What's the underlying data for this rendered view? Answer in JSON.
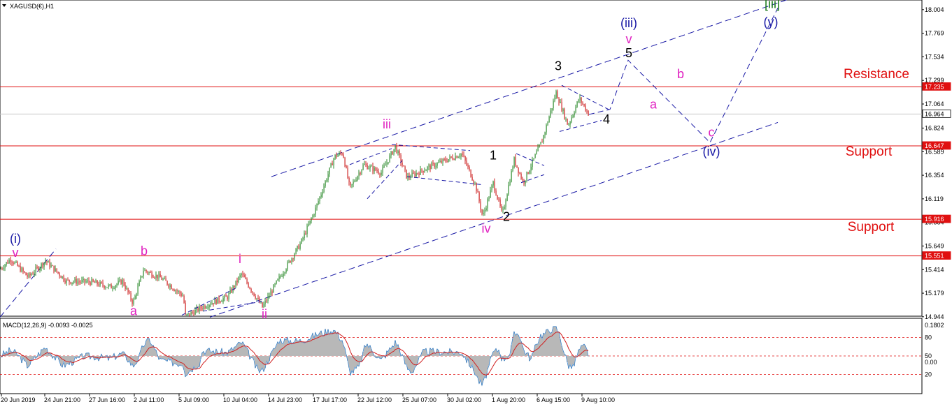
{
  "symbol_label": "XAGUSD(€),H1",
  "macd_label": "MACD(12,26,9) -0.0093 -0.0025",
  "chart_data": {
    "type": "line",
    "price_axis": {
      "ticks": [
        "18.004",
        "17.769",
        "17.534",
        "17.299",
        "17.064",
        "16.824",
        "16.589",
        "16.354",
        "16.119",
        "15.884",
        "15.649",
        "15.414",
        "15.179",
        "14.944"
      ],
      "range": [
        14.95,
        18.1
      ]
    },
    "price_tags": [
      {
        "value": "17.235",
        "highlight": true
      },
      {
        "value": "16.964",
        "highlight": false
      },
      {
        "value": "16.647",
        "highlight": true
      },
      {
        "value": "15.916",
        "highlight": true
      },
      {
        "value": "15.551",
        "highlight": true
      }
    ],
    "horizontal_levels": [
      17.235,
      16.647,
      15.916,
      15.551
    ],
    "current_price": 16.964,
    "time_axis": [
      "20 Jun 2019",
      "24 Jun 21:00",
      "27 Jun 16:00",
      "2 Jul 11:00",
      "5 Jul 09:00",
      "10 Jul 04:00",
      "14 Jul 23:00",
      "17 Jul 17:00",
      "22 Jul 12:00",
      "25 Jul 07:00",
      "30 Jul 02:00",
      "1 Aug 20:00",
      "6 Aug 15:00",
      "9 Aug 10:00"
    ],
    "price_path": [
      {
        "t": 0,
        "p": 15.42
      },
      {
        "t": 15,
        "p": 15.52
      },
      {
        "t": 40,
        "p": 15.34
      },
      {
        "t": 65,
        "p": 15.5
      },
      {
        "t": 95,
        "p": 15.3
      },
      {
        "t": 130,
        "p": 15.29
      },
      {
        "t": 158,
        "p": 15.24
      },
      {
        "t": 175,
        "p": 15.3
      },
      {
        "t": 190,
        "p": 15.08
      },
      {
        "t": 205,
        "p": 15.41
      },
      {
        "t": 230,
        "p": 15.33
      },
      {
        "t": 262,
        "p": 15.15
      },
      {
        "t": 265,
        "p": 14.95
      },
      {
        "t": 300,
        "p": 15.08
      },
      {
        "t": 325,
        "p": 15.14
      },
      {
        "t": 345,
        "p": 15.37
      },
      {
        "t": 375,
        "p": 15.04
      },
      {
        "t": 395,
        "p": 15.28
      },
      {
        "t": 430,
        "p": 15.68
      },
      {
        "t": 450,
        "p": 16.0
      },
      {
        "t": 478,
        "p": 16.54
      },
      {
        "t": 490,
        "p": 16.58
      },
      {
        "t": 500,
        "p": 16.22
      },
      {
        "t": 520,
        "p": 16.46
      },
      {
        "t": 545,
        "p": 16.38
      },
      {
        "t": 565,
        "p": 16.64
      },
      {
        "t": 582,
        "p": 16.33
      },
      {
        "t": 615,
        "p": 16.44
      },
      {
        "t": 660,
        "p": 16.57
      },
      {
        "t": 680,
        "p": 16.25
      },
      {
        "t": 690,
        "p": 15.94
      },
      {
        "t": 705,
        "p": 16.28
      },
      {
        "t": 718,
        "p": 15.96
      },
      {
        "t": 735,
        "p": 16.51
      },
      {
        "t": 748,
        "p": 16.28
      },
      {
        "t": 775,
        "p": 16.7
      },
      {
        "t": 795,
        "p": 17.18
      },
      {
        "t": 812,
        "p": 16.85
      },
      {
        "t": 828,
        "p": 17.12
      },
      {
        "t": 842,
        "p": 16.96
      }
    ],
    "projection": [
      {
        "t": 842,
        "p": 16.96
      },
      {
        "t": 872,
        "p": 17.01
      },
      {
        "t": 898,
        "p": 17.5
      },
      {
        "t": 1015,
        "p": 16.68
      },
      {
        "t": 1112,
        "p": 18.02
      }
    ],
    "channels": [
      {
        "from": {
          "t": 388,
          "p": 16.34
        },
        "to": {
          "t": 1145,
          "p": 18.15
        }
      },
      {
        "from": {
          "t": 0,
          "p": 14.94
        },
        "to": {
          "t": 80,
          "p": 15.62
        }
      },
      {
        "from": {
          "t": 300,
          "p": 14.94
        },
        "to": {
          "t": 1112,
          "p": 16.88
        }
      }
    ],
    "wave_labels": [
      {
        "text": "(i)",
        "t": 22,
        "p": 15.68,
        "color": "#1a1aa6"
      },
      {
        "text": "v",
        "t": 22,
        "p": 15.54,
        "color": "#e020c0"
      },
      {
        "text": "b",
        "t": 206,
        "p": 15.56,
        "color": "#e020c0"
      },
      {
        "text": "a",
        "t": 191,
        "p": 14.96,
        "color": "#e020c0"
      },
      {
        "text": "i",
        "t": 343,
        "p": 15.48,
        "color": "#e020c0"
      },
      {
        "text": "ii",
        "t": 378,
        "p": 14.93,
        "color": "#e020c0"
      },
      {
        "text": "iii",
        "t": 553,
        "p": 16.82,
        "color": "#e020c0"
      },
      {
        "text": "iv",
        "t": 695,
        "p": 15.78,
        "color": "#e020c0"
      },
      {
        "text": "1",
        "t": 705,
        "p": 16.51,
        "color": "#000000"
      },
      {
        "text": "2",
        "t": 724,
        "p": 15.9,
        "color": "#000000"
      },
      {
        "text": "3",
        "t": 798,
        "p": 17.4,
        "color": "#000000"
      },
      {
        "text": "4",
        "t": 867,
        "p": 16.87,
        "color": "#000000"
      },
      {
        "text": "5",
        "t": 899,
        "p": 17.53,
        "color": "#000000"
      },
      {
        "text": "(iii)",
        "t": 899,
        "p": 17.83,
        "color": "#1a1aa6"
      },
      {
        "text": "v",
        "t": 899,
        "p": 17.67,
        "color": "#e020c0"
      },
      {
        "text": "a",
        "t": 934,
        "p": 17.02,
        "color": "#e020c0"
      },
      {
        "text": "b",
        "t": 973,
        "p": 17.32,
        "color": "#e020c0"
      },
      {
        "text": "c",
        "t": 1017,
        "p": 16.74,
        "color": "#e020c0"
      },
      {
        "text": "(iv)",
        "t": 1017,
        "p": 16.55,
        "color": "#1a1aa6"
      },
      {
        "text": "[iii]",
        "t": 1104,
        "p": 18.02,
        "color": "#1b7a1b"
      },
      {
        "text": "(y)",
        "t": 1102,
        "p": 17.84,
        "color": "#1a1aa6"
      }
    ],
    "annotations": [
      {
        "text": "Resistance",
        "t": 1253,
        "p": 17.32
      },
      {
        "text": "Support",
        "t": 1242,
        "p": 16.55
      },
      {
        "text": "Support",
        "t": 1245,
        "p": 15.8
      }
    ],
    "macd": {
      "ticks": [
        "0.1802",
        "80",
        "50",
        "0.00",
        "20"
      ],
      "levels": [
        80,
        50,
        20
      ]
    },
    "colors": {
      "up": "#2e8b2e",
      "down": "#cc2222",
      "level": "#e01010",
      "channel": "#1a1aa6",
      "macd_line": "#3a86d0",
      "signal": "#d02020",
      "histogram": "#b8b8b8"
    }
  }
}
